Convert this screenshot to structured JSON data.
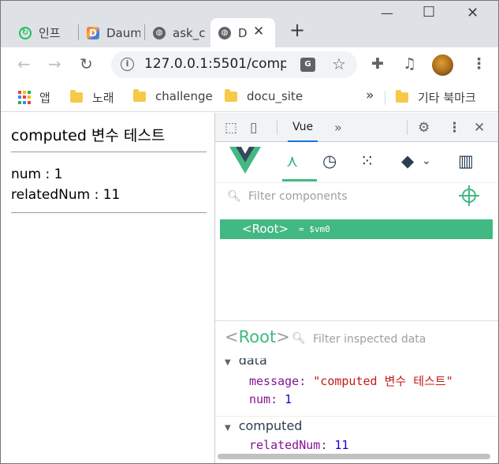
{
  "browser": {
    "tabs": [
      {
        "label": "인프",
        "favicon_color": "#20c05c"
      },
      {
        "label": "Daum",
        "favicon_color": "#4f6bff"
      },
      {
        "label": "ask_c",
        "favicon_color": "#5f6368"
      },
      {
        "label": "D",
        "favicon_color": "#5f6368",
        "active": true
      }
    ],
    "new_tab_symbol": "+",
    "close_symbol": "✕",
    "url": "127.0.0.1:5501/comp...",
    "bookmarks": {
      "apps_label": "앱",
      "items": [
        "노래",
        "challenge",
        "docu_site"
      ],
      "overflow": "»",
      "other": "기타 북마크"
    }
  },
  "page": {
    "title": "computed 변수 테스트",
    "num_line": "num : 1",
    "related_line": "relatedNum : 11"
  },
  "devtools": {
    "active_tab": "Vue",
    "more_tabs": "»",
    "filter_components_placeholder": "Filter components",
    "root_component": "<Root>",
    "vm_ref": "= $vm0",
    "inspector": {
      "component_open": "<",
      "component_name": "Root",
      "component_close": ">",
      "filter_placeholder": "Filter inspected data",
      "data_section": "data",
      "data_items": [
        {
          "key": "message",
          "value": "\"computed 변수 테스트\"",
          "type": "string"
        },
        {
          "key": "num",
          "value": "1",
          "type": "number"
        }
      ],
      "computed_section": "computed",
      "computed_items": [
        {
          "key": "relatedNum",
          "value": "11",
          "type": "number"
        }
      ]
    }
  },
  "colors": {
    "vue_green": "#42b883",
    "vue_dark": "#35495e",
    "chrome_blue": "#1a73e8"
  }
}
